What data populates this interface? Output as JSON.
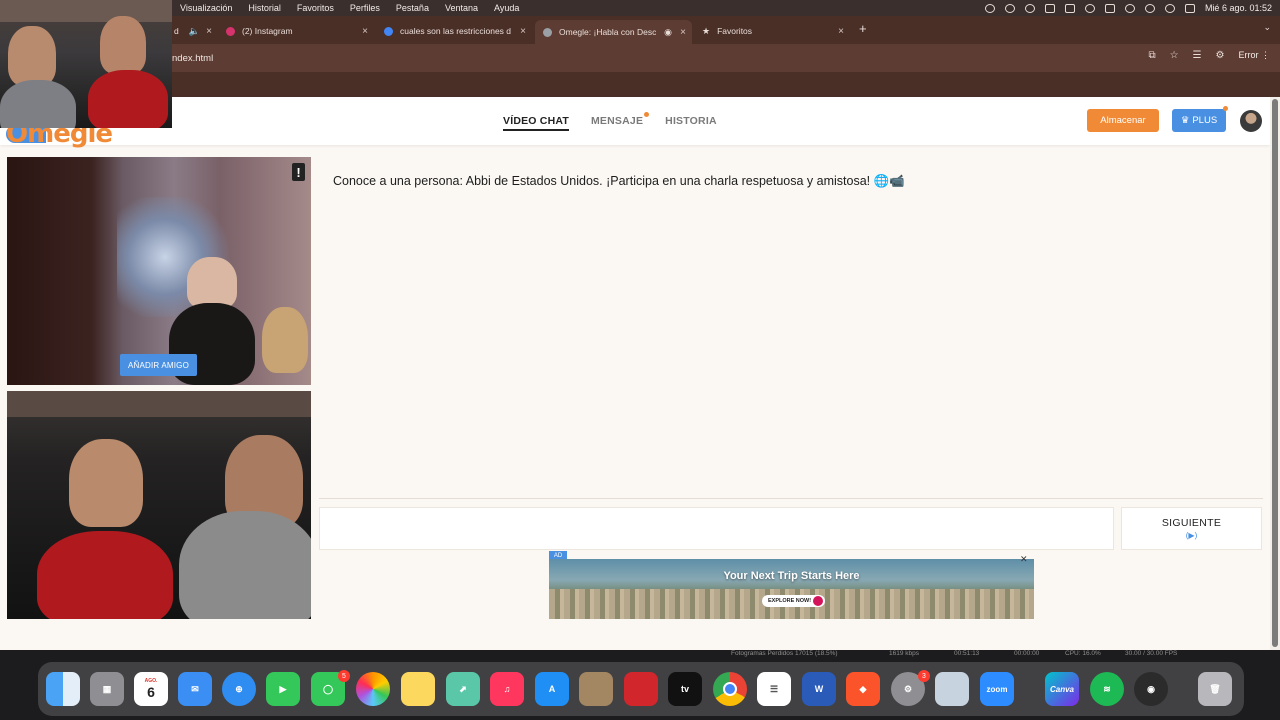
{
  "menubar": {
    "items": [
      "Visualización",
      "Historial",
      "Favoritos",
      "Perfiles",
      "Pestaña",
      "Ventana",
      "Ayuda"
    ],
    "datetime": "Mié 6 ago.  01:52"
  },
  "tabs": [
    {
      "label": "d",
      "favicon_color": "#f2f2f2"
    },
    {
      "label": "(2) Instagram",
      "favicon_color": "#d6336c"
    },
    {
      "label": "cuales son las restricciones d",
      "favicon_color": "#4285f4"
    },
    {
      "label": "Omegle: ¡Habla con Desc",
      "favicon_color": "#9aa0a6",
      "active": true
    },
    {
      "label": "Favoritos",
      "favicon_color": "#cfcfcf"
    }
  ],
  "address": {
    "url": "ndex.html",
    "status": "Error"
  },
  "site": {
    "logo_text": "Omegle",
    "nav": [
      {
        "label": "VÍDEO CHAT",
        "active": true
      },
      {
        "label": "MENSAJE",
        "dot": true
      },
      {
        "label": "HISTORIA"
      }
    ],
    "store_button": "Almacenar",
    "plus_button": "PLUS",
    "add_friend_button": "AÑADIR AMIGO",
    "report_glyph": "!",
    "chat_message": "Conoce a una persona: Abbi de Estados Unidos. ¡Participa en una charla respetuosa y amistosa! 🌐📹",
    "chat_input_placeholder": "",
    "next_button": "SIGUIENTE",
    "next_button_sub": "(▶)"
  },
  "ad": {
    "tag": "AD",
    "title": "Your Next Trip Starts Here",
    "cta": "EXPLORE NOW!",
    "close": "✕"
  },
  "obs_stats": {
    "dropped_frames": "Fotogramas Perdidos 17015 (18.5%)",
    "bitrate": "1619 kbps",
    "rec_time": "00:51:13",
    "stream_time": "00:00:00",
    "cpu": "CPU: 16.0%",
    "fps": "30.00 / 30.00 FPS"
  },
  "dock": {
    "calendar_month": "AGO.",
    "calendar_day": "6",
    "messages_badge": "5",
    "settings_badge": "3",
    "apps": [
      "finder-icon",
      "launchpad-icon",
      "calendar-icon",
      "mail-icon",
      "safari-icon",
      "facetime-icon",
      "messages-icon",
      "photos-icon",
      "notes-icon",
      "maps-icon",
      "music-icon",
      "app-store-icon",
      "contacts-icon",
      "photo-booth-icon",
      "apple-tv-icon",
      "chrome-icon",
      "reminders-icon",
      "word-icon",
      "brave-icon",
      "system-settings-icon",
      "preview-icon",
      "zoom-icon",
      "canva-icon",
      "spotify-icon",
      "obs-icon",
      "trash-icon"
    ],
    "zoom_label": "zoom",
    "canva_label": "Canva",
    "tv_label": "tv"
  }
}
